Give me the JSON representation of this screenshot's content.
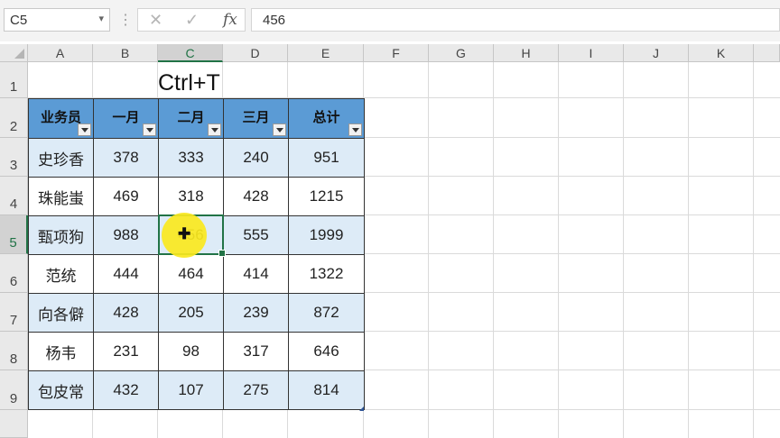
{
  "formula_bar": {
    "name_box": "C5",
    "name_box_arrow": "▾",
    "separator": "⋮",
    "cancel_icon_glyph": "✕",
    "enter_icon_glyph": "✓",
    "fx_label": "fx",
    "formula_value": "456"
  },
  "columns": [
    "A",
    "B",
    "C",
    "D",
    "E",
    "F",
    "G",
    "H",
    "I",
    "J",
    "K"
  ],
  "rows": [
    "1",
    "2",
    "3",
    "4",
    "5",
    "6",
    "7",
    "8",
    "9"
  ],
  "title": "Ctrl+T",
  "table": {
    "headers": [
      "业务员",
      "一月",
      "二月",
      "三月",
      "总计"
    ],
    "rows": [
      [
        "史珍香",
        "378",
        "333",
        "240",
        "951"
      ],
      [
        "珠能蚩",
        "469",
        "318",
        "428",
        "1215"
      ],
      [
        "甄项狗",
        "988",
        "456",
        "555",
        "1999"
      ],
      [
        "范统",
        "444",
        "464",
        "414",
        "1322"
      ],
      [
        "向各僻",
        "428",
        "205",
        "239",
        "872"
      ],
      [
        "杨韦",
        "231",
        "98",
        "317",
        "646"
      ],
      [
        "包皮常",
        "432",
        "107",
        "275",
        "814"
      ]
    ]
  },
  "selection": {
    "cell": "C5"
  },
  "colors": {
    "header_fill": "#5b9bd5",
    "band_fill": "#ddebf7",
    "selection_border": "#217346",
    "cursor_highlight": "#fae81e"
  },
  "icons": {
    "cursor": "move-cursor-icon",
    "filter": "filter-dropdown-icon"
  }
}
